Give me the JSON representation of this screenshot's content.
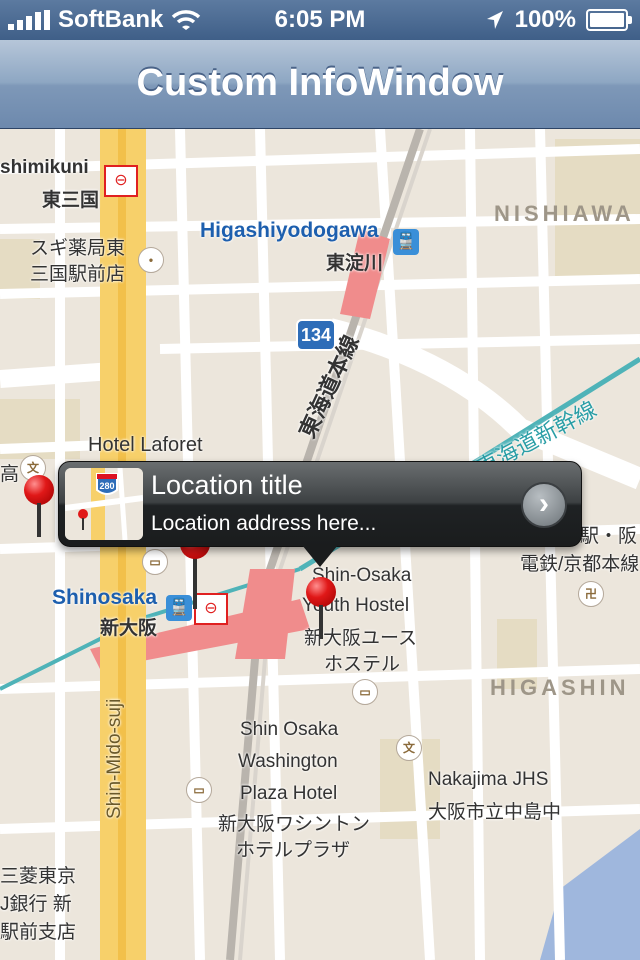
{
  "status_bar": {
    "carrier": "SoftBank",
    "time": "6:05 PM",
    "battery": "100%"
  },
  "nav_bar": {
    "title": "Custom InfoWindow"
  },
  "map": {
    "labels": {
      "shimikuni": "shimikuni",
      "higashimikuni_jp": "東三国",
      "sugi_1": "スギ薬局東",
      "sugi_2": "三国駅前店",
      "higashiyodogawa": "Higashiyodogawa",
      "higashiyodogawa_jp": "東淀川",
      "nishiawa": "NISHIAWA",
      "route": "134",
      "tokaido_line": "東海道本線",
      "shinkansen": "東海道新幹線",
      "hotel_laforet": "Hotel Laforet",
      "taka": "高",
      "shin_osaka_stn_1": "駅・阪",
      "shin_osaka_stn_2": "電鉄/京都本線",
      "shinosaka": "Shinosaka",
      "shinosaka_jp": "新大阪",
      "youth_1": "Shin-Osaka",
      "youth_2": "Youth Hostel",
      "youth_3": "新大阪ユース",
      "youth_4": "ホステル",
      "higashin": "HIGASHIN",
      "washington_1": "Shin Osaka",
      "washington_2": "Washington",
      "washington_3": "Plaza Hotel",
      "washington_4": "新大阪ワシントン",
      "washington_5": "ホテルプラザ",
      "mido_suji": "Shin-Mido-suji",
      "nakajima_1": "Nakajima JHS",
      "nakajima_2": "大阪市立中島中",
      "bank_1": "三菱東京",
      "bank_2": "J銀行 新",
      "bank_3": "駅前支店",
      "route_280": "280"
    }
  },
  "info_window": {
    "title": "Location title",
    "address": "Location address here...",
    "disclosure": "›"
  },
  "colors": {
    "nav_bar": "#7e98b8",
    "status_bar": "#4a6a92",
    "info_window": "#2a2d2f",
    "pin": "#e01818",
    "highway": "#f7d06a",
    "rail_highlight": "#f08c8c"
  }
}
